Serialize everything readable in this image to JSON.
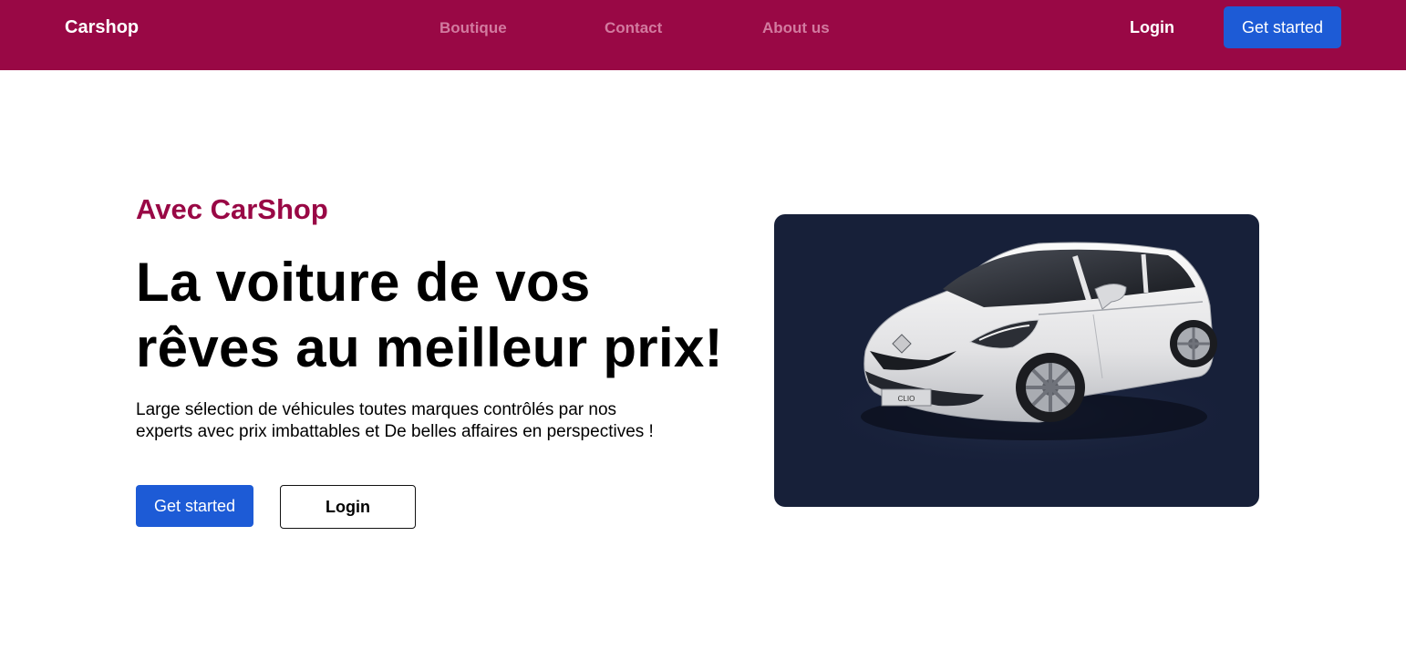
{
  "nav": {
    "brand": "Carshop",
    "links": [
      {
        "label": "Boutique"
      },
      {
        "label": "Contact"
      },
      {
        "label": "About us"
      }
    ],
    "login_label": "Login",
    "cta_label": "Get started"
  },
  "hero": {
    "eyebrow": "Avec CarShop",
    "headline_line1": "La voiture de vos",
    "headline_line2": "rêves au meilleur prix!",
    "description_line1": "Large sélection de véhicules toutes marques contrôlés par nos",
    "description_line2": "experts avec prix imbattables et De belles affaires en perspectives !",
    "primary_button": "Get started",
    "secondary_button": "Login",
    "image": {
      "subject": "white-hatchback-car",
      "plate_text": "CLIO"
    }
  },
  "colors": {
    "brand": "#990845",
    "nav_link": "#d27a9f",
    "accent": "#1d5bd6",
    "image_bg": "#172039"
  }
}
